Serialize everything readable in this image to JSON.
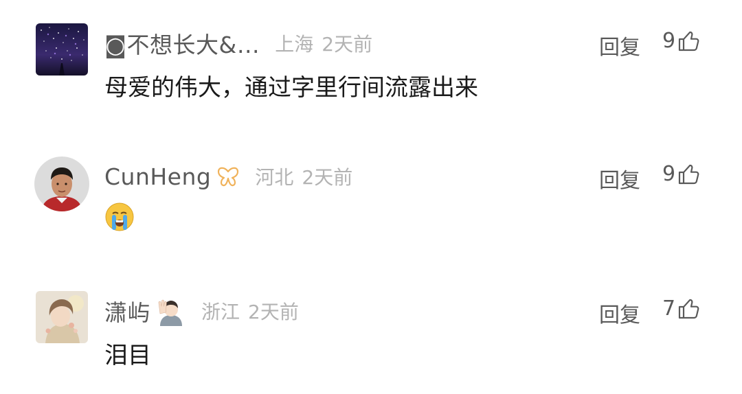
{
  "comments": [
    {
      "username": "◙不想长大&…",
      "location": "上海",
      "time": "2天前",
      "content": "母爱的伟大，通过字里行间流露出来",
      "reply_label": "回复",
      "likes": "9",
      "avatar": "starry-night-avatar"
    },
    {
      "username": "CunHeng",
      "location": "河北",
      "time": "2天前",
      "content": "",
      "content_emoji": "crying-face-emoji",
      "reply_label": "回复",
      "likes": "9",
      "avatar": "man-portrait-avatar",
      "badge": "butterfly-badge-icon"
    },
    {
      "username": "潇屿",
      "location": "浙江",
      "time": "2天前",
      "content": "泪目",
      "reply_label": "回复",
      "likes": "7",
      "avatar": "illustrated-girl-avatar",
      "badge": "waving-person-emoji"
    }
  ],
  "colors": {
    "text_primary": "#1a1a1a",
    "text_secondary": "#595959",
    "text_muted": "#b3b3b3",
    "butterfly_badge": "#f0b25a"
  }
}
